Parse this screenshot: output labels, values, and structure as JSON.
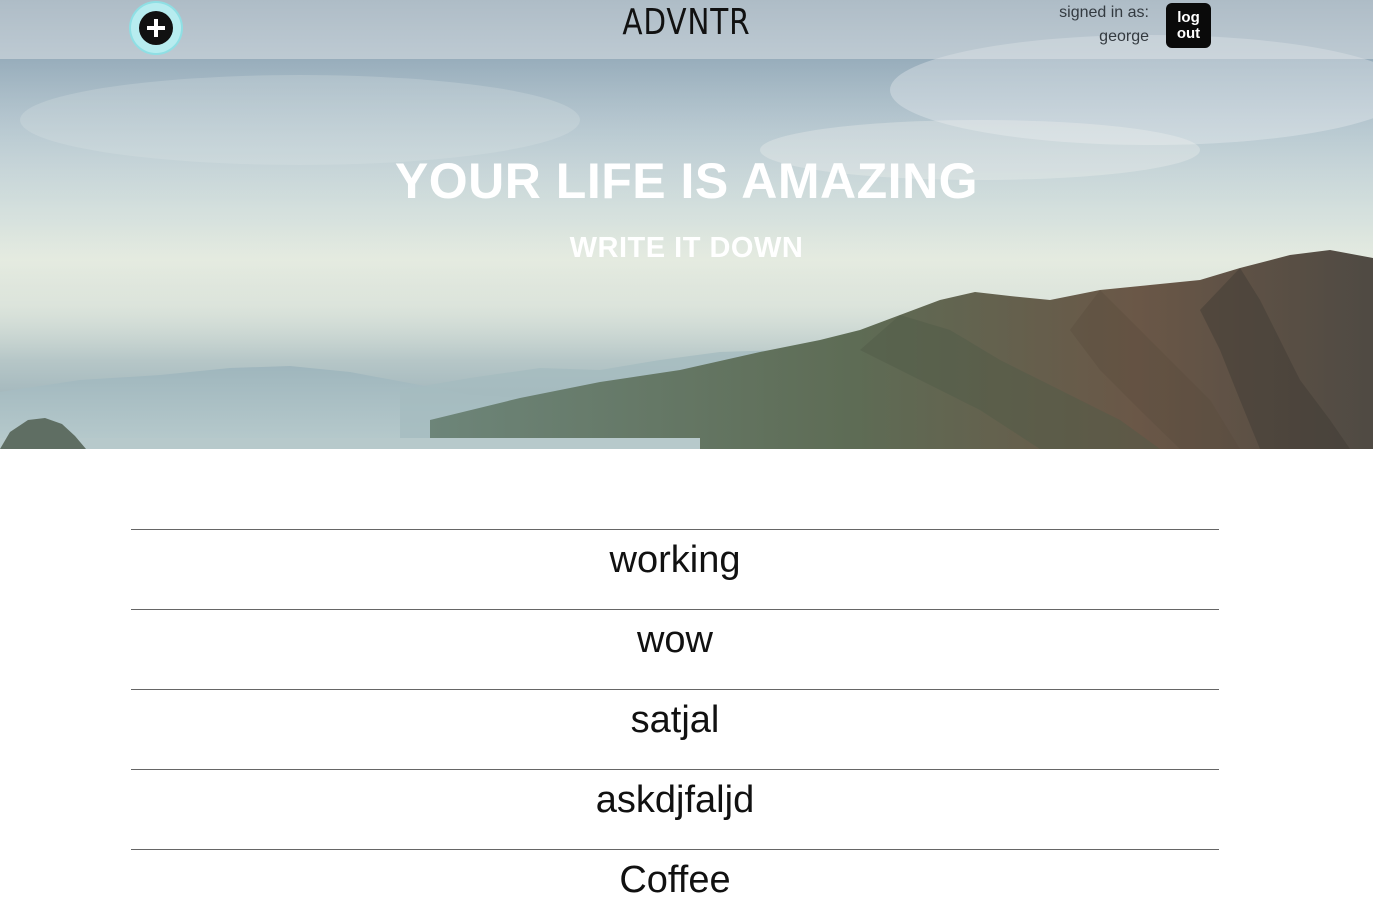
{
  "header": {
    "add_icon": "plus-circle-icon",
    "logo": "ADVNTR",
    "signed_in_label": "signed in as:",
    "username": "george",
    "logout_line1": "log",
    "logout_line2": "out"
  },
  "hero": {
    "title": "YOUR LIFE IS AMAZING",
    "subtitle": "WRITE IT DOWN"
  },
  "entries": [
    {
      "title": "working"
    },
    {
      "title": "wow"
    },
    {
      "title": "satjal"
    },
    {
      "title": "askdjfaljd"
    },
    {
      "title": "Coffee"
    }
  ],
  "colors": {
    "accent_ring": "#b7ecef",
    "button_bg": "#0a0a0a",
    "divider": "#666666"
  }
}
